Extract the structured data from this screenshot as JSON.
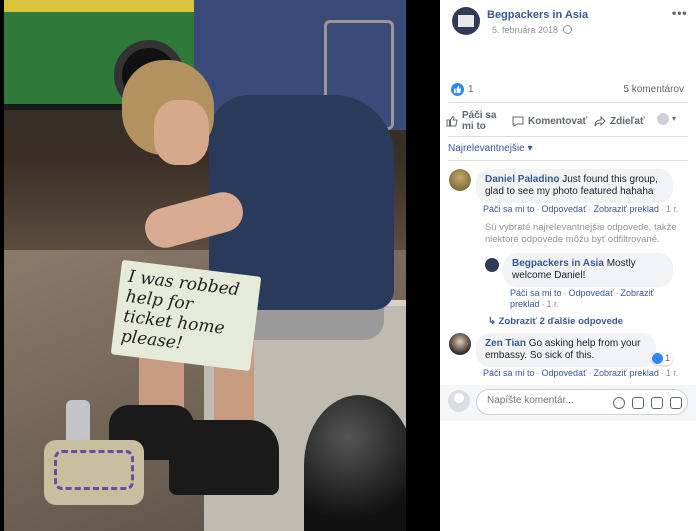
{
  "post": {
    "page_name": "Begpackers in Asia",
    "date": "5. februára 2018 ·",
    "more": "•••",
    "likes": "1",
    "comments_count": "5 komentárov",
    "photo_sign_lines": [
      "I was robbed",
      "help for",
      "ticket home",
      "please!"
    ]
  },
  "actions": {
    "like": "Páči sa mi to",
    "comment": "Komentovať",
    "share": "Zdieľať",
    "caret": "▾"
  },
  "sort": {
    "label": "Najrelevantnejšie ▾"
  },
  "comments": [
    {
      "author": "Daniel Paladino",
      "text": "Just found this group, glad to see my photo featured hahaha",
      "actions": [
        "Páči sa mi to",
        "Odpovedať",
        "Zobraziť preklad"
      ],
      "time": "1 r."
    },
    {
      "author": "Begpackers in Asia",
      "text": "Mostly welcome Daniel!",
      "actions": [
        "Páči sa mi to",
        "Odpovedať",
        "Zobraziť preklad"
      ],
      "time": "1 r."
    },
    {
      "author": "Zen Tian",
      "text": "Go asking help from your embassy. So sick of this.",
      "actions": [
        "Páči sa mi to",
        "Odpovedať",
        "Zobraziť preklad"
      ],
      "time": "1 r.",
      "reaction_count": "1"
    }
  ],
  "filtered_notice": "Sú vybraté najrelevantnejšie odpovede, takže niektoré odpovede môžu byť odfiltrované.",
  "more_replies": "↳   Zobraziť 2 ďalšie odpovede",
  "composer": {
    "placeholder": "Napíšte komentár..."
  },
  "colors": {
    "link": "#385898",
    "meta": "#90949c",
    "accent": "#2d88ff"
  }
}
